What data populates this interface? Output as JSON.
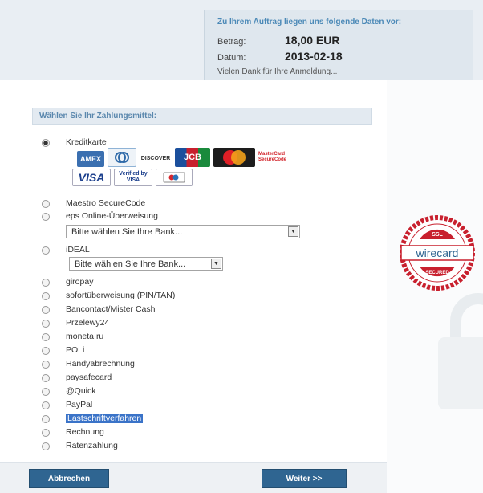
{
  "order": {
    "heading": "Zu Ihrem Auftrag liegen uns folgende Daten vor:",
    "amount_label": "Betrag:",
    "amount_value": "18,00  EUR",
    "date_label": "Datum:",
    "date_value": "2013-02-18",
    "thanks": "Vielen Dank für Ihre Anmeldung..."
  },
  "payment": {
    "heading": "Wählen Sie Ihr Zahlungsmittel:",
    "options": [
      {
        "label": "Kreditkarte",
        "checked": true
      },
      {
        "label": "Maestro SecureCode"
      },
      {
        "label": "eps Online-Überweisung"
      },
      {
        "label": "iDEAL"
      },
      {
        "label": "giropay"
      },
      {
        "label": "sofortüberweisung (PIN/TAN)"
      },
      {
        "label": "Bancontact/Mister Cash"
      },
      {
        "label": "Przelewy24"
      },
      {
        "label": "moneta.ru"
      },
      {
        "label": "POLi"
      },
      {
        "label": "Handyabrechnung"
      },
      {
        "label": "paysafecard"
      },
      {
        "label": "@Quick"
      },
      {
        "label": "PayPal"
      },
      {
        "label": "Lastschriftverfahren",
        "highlighted": true
      },
      {
        "label": "Rechnung"
      },
      {
        "label": "Ratenzahlung"
      }
    ],
    "eps_select": "Bitte wählen Sie Ihre Bank...",
    "ideal_select": "Bitte wählen Sie Ihre Bank..."
  },
  "cards": {
    "discover": "DISCOVER",
    "jcb": "JCB",
    "mastercard": "MasterCard",
    "mastercard_secure": "MasterCard SecureCode",
    "visa": "VISA",
    "verified_visa": "Verified by VISA",
    "american_express": "AMEX"
  },
  "seal": {
    "top_text": "SSL",
    "brand": "wirecard",
    "bottom_text": "SECURED"
  },
  "buttons": {
    "cancel": "Abbrechen",
    "next": "Weiter >>"
  },
  "colors": {
    "brand_blue": "#2f6591",
    "heading_blue": "#4b89b7",
    "seal_red": "#c8202e",
    "highlight": "#3a73c8"
  }
}
